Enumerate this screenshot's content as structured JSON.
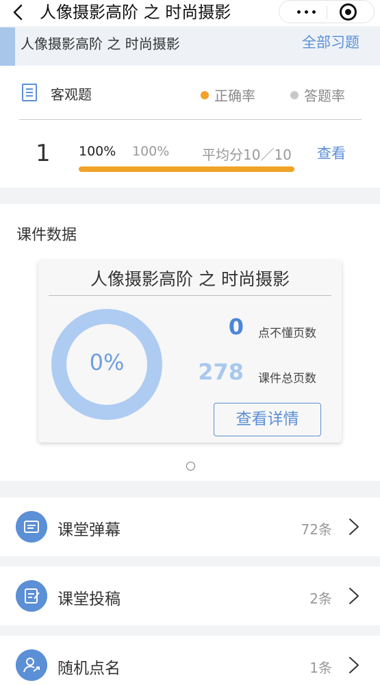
{
  "nav": {
    "title": "人像摄影高阶 之 时尚摄影",
    "back_icon": "chevron-left-icon",
    "more_icon": "more-dots-icon",
    "close_icon": "target-close-icon"
  },
  "quiz_header": {
    "title": "人像摄影高阶 之 时尚摄影",
    "all_exercises": "全部习题"
  },
  "objective": {
    "title": "客观题",
    "icon": "document-icon",
    "legend": [
      {
        "label": "正确率",
        "color": "#f0a326"
      },
      {
        "label": "答题率",
        "color": "#c8c8c8"
      }
    ],
    "question": {
      "index": "1",
      "correct_rate": "100%",
      "answer_rate": "100%",
      "average": "平均分10／10",
      "view": "查看",
      "progress": 1.0
    }
  },
  "courseware": {
    "section_title": "课件数据",
    "card_title": "人像摄影高阶 之 时尚摄影",
    "percent": "0%",
    "ring_fraction": 0.0,
    "not_understood": {
      "value": "0",
      "label": "点不懂页数",
      "color": "#4a86d8"
    },
    "total_pages": {
      "value": "278",
      "label": "课件总页数",
      "color": "#a9c8ef"
    },
    "detail_button": "查看详情"
  },
  "colors": {
    "accent": "#5b8fd6",
    "progress": "#f0a326",
    "ring": "#aecbf2"
  },
  "list": [
    {
      "label": "课堂弹幕",
      "count": "72条",
      "icon": "message-icon"
    },
    {
      "label": "课堂投稿",
      "count": "2条",
      "icon": "edit-note-icon"
    },
    {
      "label": "随机点名",
      "count": "1条",
      "icon": "random-user-icon"
    }
  ]
}
